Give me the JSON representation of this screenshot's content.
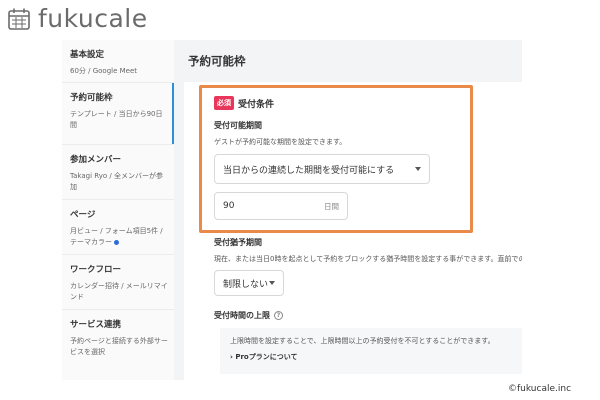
{
  "logo": {
    "icon": "calendar-icon",
    "text": "fukucale"
  },
  "sidebar": {
    "items": [
      {
        "title": "基本設定",
        "desc": "60分 / Google Meet"
      },
      {
        "title": "予約可能枠",
        "desc": "テンプレート / 当日から90日間"
      },
      {
        "title": "参加メンバー",
        "desc": "Takagi Ryo / 全メンバーが参加"
      },
      {
        "title": "ページ",
        "desc": "月ビュー / フォーム項目5件 / テーマカラー"
      },
      {
        "title": "ワークフロー",
        "desc": "カレンダー招待 / メールリマインド"
      },
      {
        "title": "サービス連携",
        "desc": "予約ページと接続する外部サービスを選択"
      }
    ]
  },
  "main": {
    "title": "予約可能枠"
  },
  "section": {
    "badge": "必須",
    "title": "受付条件"
  },
  "acceptance_period": {
    "label": "受付可能期間",
    "desc": "ゲストが予約可能な期間を設定できます。",
    "select_value": "当日からの連続した期間を受付可能にする",
    "input_value": "90",
    "input_unit": "日間"
  },
  "grace_period": {
    "label": "受付猶予期間",
    "desc": "現在、または当日0時を起点として予約をブロックする猶予時間を設定する事ができます。直前での",
    "select_value": "制限しない"
  },
  "limit": {
    "label": "受付時間の上限",
    "info_icon": "question-icon"
  },
  "notice": {
    "text": "上限時間を設定することで、上限時間以上の予約受付を不可とすることができます。",
    "link": "Proプランについて"
  },
  "copyright": "©fukucale.inc",
  "colors": {
    "highlight": "#ea8a4a",
    "badge": "#e8375a",
    "active": "#2f8fd7"
  }
}
